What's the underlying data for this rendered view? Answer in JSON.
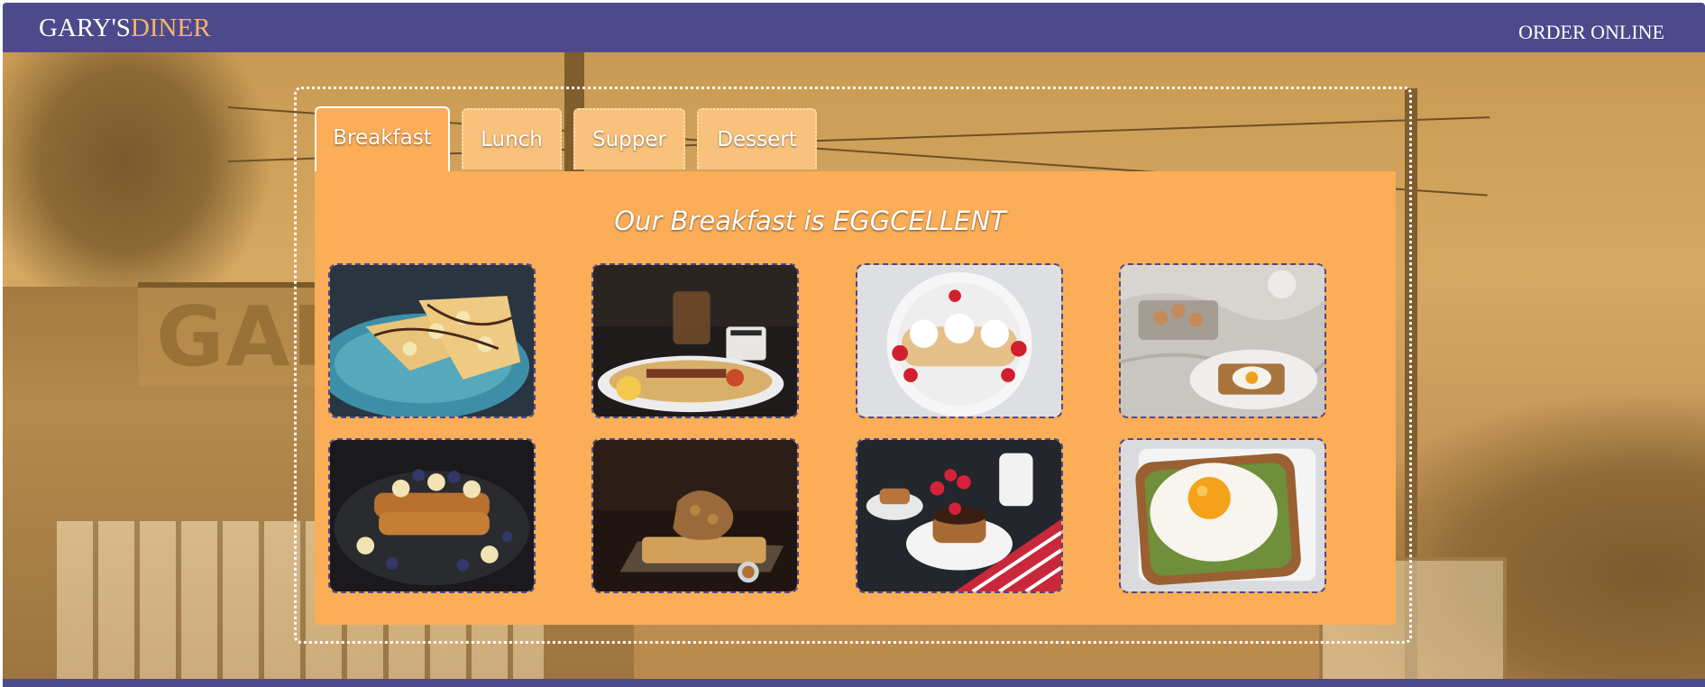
{
  "header": {
    "brand_part1": "GARY'S",
    "brand_part2": "DINER",
    "order_link": "ORDER ONLINE",
    "bar_color": "#4c4a8a",
    "brand_accent_color": "#f7b46a"
  },
  "background": {
    "sign_text": "GARY"
  },
  "menu": {
    "tabs": [
      {
        "label": "Breakfast",
        "active": true
      },
      {
        "label": "Lunch",
        "active": false
      },
      {
        "label": "Supper",
        "active": false
      },
      {
        "label": "Dessert",
        "active": false
      }
    ],
    "heading": "Our Breakfast is EGGCELLENT",
    "panel_color": "#fbad57",
    "photos": [
      {
        "subject": "crepes with bananas and chocolate drizzle"
      },
      {
        "subject": "full breakfast plate with coffee"
      },
      {
        "subject": "crepes with whipped cream and strawberries"
      },
      {
        "subject": "eggs and toast on bedsheet"
      },
      {
        "subject": "french toast with bananas and blueberries"
      },
      {
        "subject": "chicken and waffles"
      },
      {
        "subject": "pancakes with chocolate and strawberries"
      },
      {
        "subject": "fried egg on avocado toast"
      }
    ]
  }
}
